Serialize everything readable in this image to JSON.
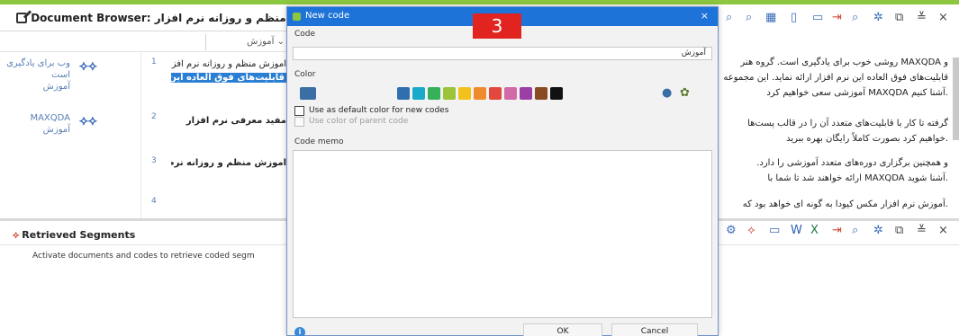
{
  "document_browser": {
    "title": "Document Browser: آموزش منظم و روزانه نرم افزار",
    "code_selector": "آموزش",
    "rows": [
      {
        "num": "1",
        "code_lines": [
          "وب برای یادگیری است",
          "آموزش"
        ],
        "text": "آموزش منظم و روزانه نرم افزار",
        "highlight": "قابلیت‌های فوق العاده این نرم افزار ارائه نماید. در این مجموعه"
      },
      {
        "num": "2",
        "code_lines": [
          "MAXQDA",
          "آموزش"
        ],
        "text": "مفید معرفی نرم افزار"
      },
      {
        "num": "3",
        "code_lines": [],
        "text": "آموزش منظم و روزانه نرم افزار"
      },
      {
        "num": "4",
        "code_lines": [],
        "text": ""
      }
    ]
  },
  "document_text": {
    "lines": [
      "و MAXQDA روشی خوب برای یادگیری است. گروه هنر",
      "قابلیت‌های فوق العاده این نرم افزار ارائه نماید. این مجموعه",
      ".آشنا کنیم MAXQDA آموزشی سعی خواهیم کرد",
      "گرفته تا کار با قابلیت‌های متعدد آن را در قالب پست‌ها",
      ".خواهیم کرد بصورت کاملاً رایگان بهره ببرید",
      "و همچنین برگزاری دوره‌های متعدد آموزشی را دارد.",
      ".آشنا شوید MAXQDA ارائه خواهند شد تا شما با",
      ".آموزش نرم افزار مکس کیودا به گونه ای خواهد بود که"
    ]
  },
  "retrieved_segments": {
    "title": "Retrieved Segments",
    "message": "Activate documents and codes to retrieve coded segm"
  },
  "dialog": {
    "title": "New code",
    "step_badge": "3",
    "code_label": "Code",
    "code_value": "آموزش",
    "color_label": "Color",
    "current_color": "#3b6ea5",
    "swatches": [
      "#2f6fb0",
      "#1aa9c9",
      "#37b05a",
      "#9bc43b",
      "#f2c21b",
      "#ef8b2c",
      "#e2483e",
      "#d16aa6",
      "#9b3fa5",
      "#8a4a23",
      "#111111"
    ],
    "use_default_label": "Use as default color for new codes",
    "use_parent_label": "Use color of parent code",
    "memo_label": "Code memo",
    "ok_label": "OK",
    "cancel_label": "Cancel"
  }
}
